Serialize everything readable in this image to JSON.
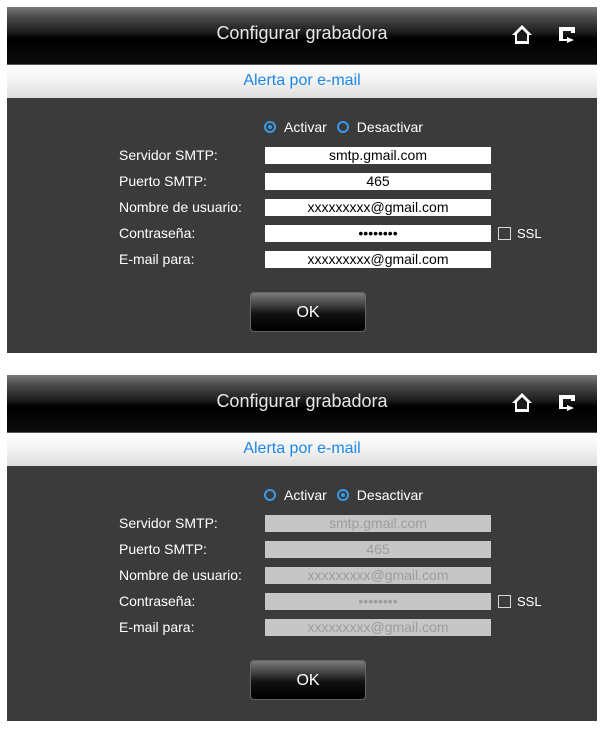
{
  "header": {
    "title": "Configurar grabadora"
  },
  "subheader": {
    "title": "Alerta por e-mail"
  },
  "icons": {
    "home": "home-icon",
    "exit": "exit-icon"
  },
  "colors": {
    "accent": "#1e87e6",
    "panel_bg": "#3b3b3b"
  },
  "form": {
    "activate_label": "Activar",
    "deactivate_label": "Desactivar",
    "smtp_server_label": "Servidor SMTP:",
    "smtp_port_label": "Puerto SMTP:",
    "username_label": "Nombre de usuario:",
    "password_label": "Contraseña:",
    "email_to_label": "E-mail para:",
    "ssl_label": "SSL",
    "ok_label": "OK"
  },
  "screens": [
    {
      "mode": "Activar",
      "smtp_server": "smtp.gmail.com",
      "smtp_port": "465",
      "username": "xxxxxxxxx@gmail.com",
      "password": "••••••••",
      "email_to": "xxxxxxxxx@gmail.com",
      "ssl_checked": false
    },
    {
      "mode": "Desactivar",
      "smtp_server": "smtp.gmail.com",
      "smtp_port": "465",
      "username": "xxxxxxxxx@gmail.com",
      "password": "••••••••",
      "email_to": "xxxxxxxxx@gmail.com",
      "ssl_checked": false
    }
  ]
}
